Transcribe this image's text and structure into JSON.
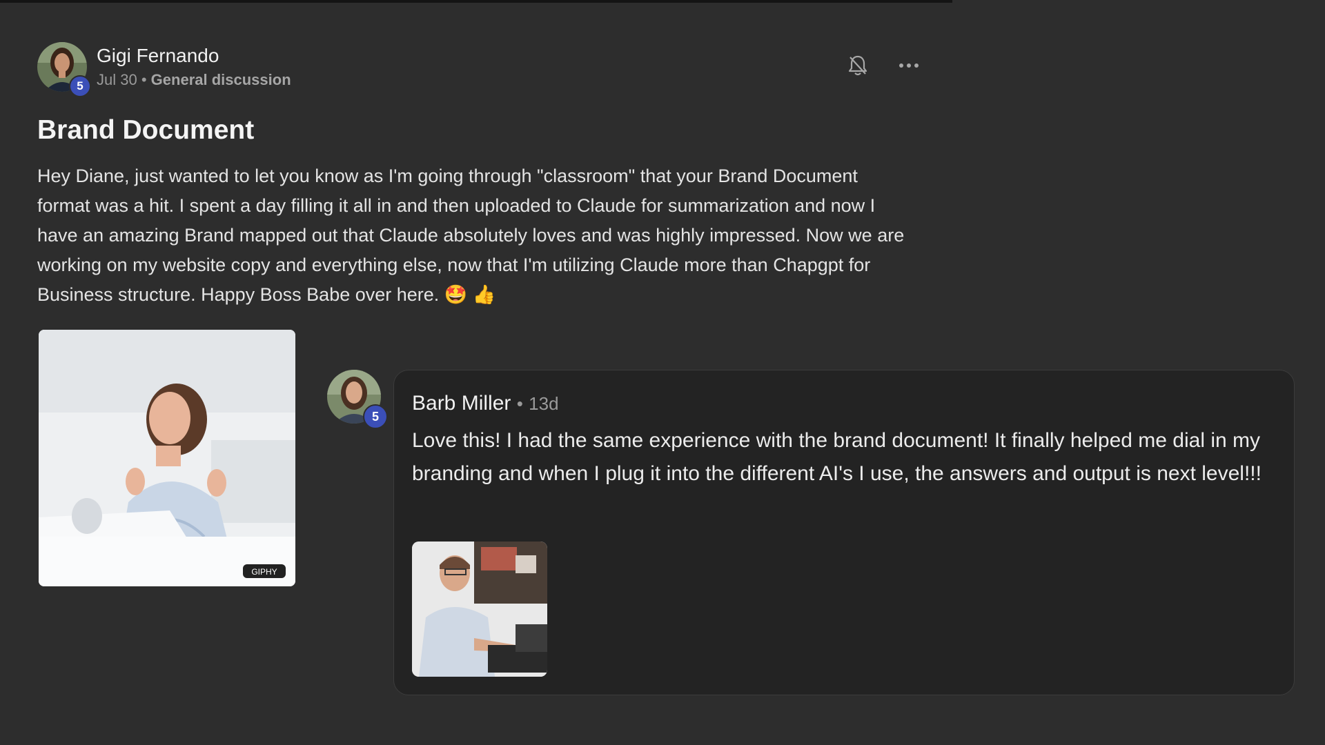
{
  "post": {
    "author": {
      "name": "Gigi Fernando",
      "level": "5",
      "avatar_icon": "user-avatar-photo"
    },
    "date": "Jul 30",
    "separator": "•",
    "category": "General discussion",
    "title": "Brand Document",
    "body": "Hey Diane, just wanted to let you know as I'm going through \"classroom\" that your Brand Document format was a hit. I spent a day filling it all in and then uploaded to Claude for summarization and now I have an amazing Brand mapped out that Claude absolutely loves and was highly impressed. Now we are working on my website copy and everything else, now that I'm utilizing Claude more than Chapgpt for Business structure. Happy Boss Babe over here. 🤩 👍",
    "actions": {
      "notify_icon": "bell-off-icon",
      "more_icon": "more-horizontal-icon"
    },
    "image": {
      "description_icon": "woman-at-laptop-gif",
      "watermark": "GIPHY"
    }
  },
  "comment": {
    "author": {
      "name": "Barb Miller",
      "level": "5",
      "avatar_icon": "user-avatar-photo"
    },
    "separator": "•",
    "time": "13d",
    "text": "Love this! I had the same experience with the brand document! It finally helped me dial in my branding and when I plug it into the different AI's I use, the answers and output is next level!!!",
    "image": {
      "description_icon": "man-typing-gif"
    }
  },
  "colors": {
    "background": "#2d2d2d",
    "card": "#232323",
    "badge": "#3b4fb8",
    "text_primary": "#f2f2f2",
    "text_muted": "#9a9a9a"
  }
}
